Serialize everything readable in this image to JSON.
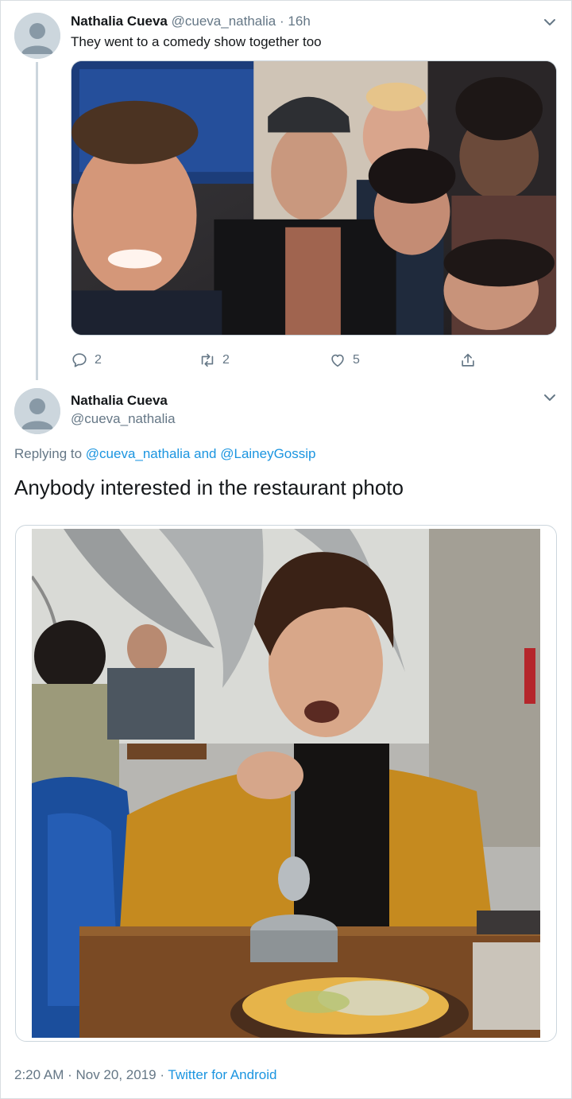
{
  "thread_tweet": {
    "author_name": "Nathalia Cueva",
    "author_handle": "@cueva_nathalia",
    "time_sep": "·",
    "time": "16h",
    "text": "They went to a comedy show together too",
    "actions": {
      "reply_count": "2",
      "retweet_count": "2",
      "like_count": "5"
    }
  },
  "main_tweet": {
    "author_name": "Nathalia Cueva",
    "author_handle": "@cueva_nathalia",
    "replying_prefix": "Replying to ",
    "reply_to_1": "@cueva_nathalia",
    "reply_and": " and ",
    "reply_to_2": "@LaineyGossip",
    "text": "Anybody interested in the restaurant photo",
    "timestamp": "2:20 AM · Nov 20, 2019",
    "meta_sep": " · ",
    "source": "Twitter for Android"
  },
  "colors": {
    "link": "#1b95e0",
    "secondary_text": "#657786",
    "primary_text": "#14171a",
    "border": "#ccd6dd"
  },
  "icons": [
    "default-avatar-icon",
    "chevron-down-icon",
    "reply-icon",
    "retweet-icon",
    "like-icon",
    "share-icon"
  ]
}
